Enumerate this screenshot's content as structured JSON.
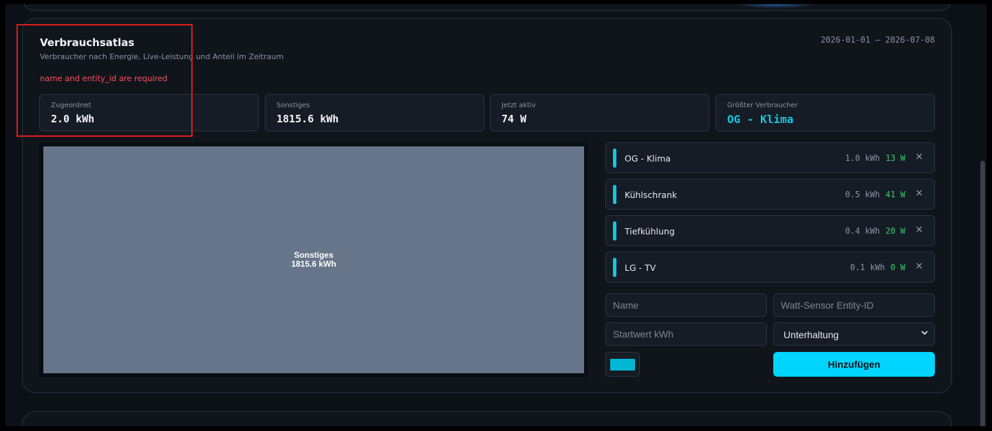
{
  "header": {
    "title": "Verbrauchsatlas",
    "subtitle": "Verbraucher nach Energie, Live-Leistung und Anteil im Zeitraum",
    "error": "name and entity_id are required",
    "date_range": "2026-01-01 – 2026-07-08"
  },
  "stats": [
    {
      "label": "Zugeordnet",
      "value": "2.0 kWh"
    },
    {
      "label": "Sonstiges",
      "value": "1815.6 kWh"
    },
    {
      "label": "Jetzt aktiv",
      "value": "74 W"
    },
    {
      "label": "Größter Verbraucher",
      "value": "OG - Klima"
    }
  ],
  "treemap": {
    "tiles": [
      {
        "name": "Sonstiges",
        "value": "1815.6 kWh",
        "color": "#667589"
      }
    ]
  },
  "consumers": [
    {
      "name": "OG - Klima",
      "kwh": "1.0 kWh",
      "watts": "13 W",
      "color": "#12c6e2"
    },
    {
      "name": "Kühlschrank",
      "kwh": "0.5 kWh",
      "watts": "41 W",
      "color": "#12c6e2"
    },
    {
      "name": "Tiefkühlung",
      "kwh": "0.4 kWh",
      "watts": "20 W",
      "color": "#12c6e2"
    },
    {
      "name": "LG - TV",
      "kwh": "0.1 kWh",
      "watts": "0 W",
      "color": "#12c6e2"
    }
  ],
  "form": {
    "name_placeholder": "Name",
    "entity_placeholder": "Watt-Sensor Entity-ID",
    "start_placeholder": "Startwert kWh",
    "category_value": "Unterhaltung",
    "color_value": "#00b8d4",
    "add_label": "Hinzufügen",
    "remove_symbol": "×"
  },
  "colors": {
    "accent": "#00d4ff",
    "live_power": "#2fd06a",
    "error": "#ff4d5a"
  }
}
